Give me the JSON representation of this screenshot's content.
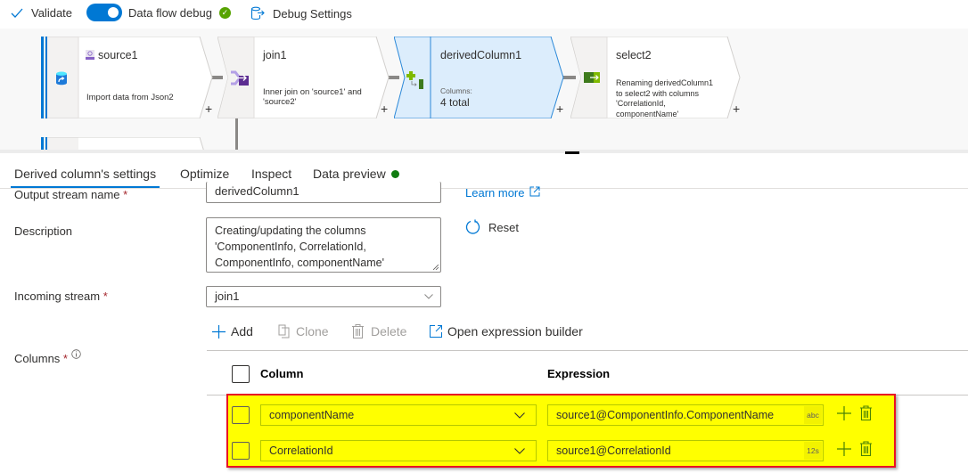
{
  "toolbar": {
    "validate_label": "Validate",
    "debug_label": "Data flow debug",
    "debug_on": true,
    "debug_settings_label": "Debug Settings"
  },
  "canvas": {
    "nodes": [
      {
        "title": "source1",
        "desc": [
          "Import data from Json2"
        ],
        "icon": "source-icon"
      },
      {
        "title": "join1",
        "desc": [
          "Inner join on 'source1' and",
          "'source2'"
        ],
        "icon": "join-icon"
      },
      {
        "title": "derivedColumn1",
        "desc_label": "Columns:",
        "desc_value": "4 total",
        "icon": "derived-column-icon",
        "selected": true
      },
      {
        "title": "select2",
        "desc": [
          "Renaming derivedColumn1",
          "to select2 with columns",
          "'CorrelationId,",
          "componentName'"
        ],
        "icon": "select-icon"
      }
    ],
    "plus": "+"
  },
  "tabs": [
    {
      "label": "Derived column's settings",
      "active": true
    },
    {
      "label": "Optimize"
    },
    {
      "label": "Inspect"
    },
    {
      "label": "Data preview",
      "status_dot": "#107c10"
    }
  ],
  "form": {
    "output_stream_label": "Output stream name",
    "output_stream_value": "derivedColumn1",
    "learn_more": "Learn more",
    "description_label": "Description",
    "description_lines": [
      "Creating/updating the columns",
      "'ComponentInfo, CorrelationId,",
      "ComponentInfo, componentName'"
    ],
    "reset_label": "Reset",
    "incoming_stream_label": "Incoming stream",
    "incoming_stream_value": "join1",
    "columns_label": "Columns",
    "required_mark": "*"
  },
  "actions": {
    "add": "Add",
    "clone": "Clone",
    "delete": "Delete",
    "open_builder": "Open expression builder"
  },
  "table": {
    "col_header": "Column",
    "expr_header": "Expression",
    "rows": [
      {
        "column": "componentName",
        "expression": "source1@ComponentInfo.ComponentName",
        "type": "abc"
      },
      {
        "column": "CorrelationId",
        "expression": "source1@CorrelationId",
        "type": "12s"
      }
    ]
  },
  "colors": {
    "accent": "#0078d4",
    "highlight": "#ffff00",
    "highlight_border": "#e81123",
    "selected_node": "#dcedfc"
  }
}
